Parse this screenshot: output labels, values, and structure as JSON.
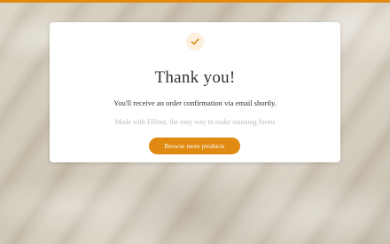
{
  "colors": {
    "accent": "#e08a12",
    "check_bg": "#fcefdc",
    "card_bg": "#ffffff"
  },
  "confirmation": {
    "icon": "check-icon",
    "title": "Thank you!",
    "message": "You'll receive an order confirmation via email shortly.",
    "made_with": "Made with Fillout, the easy way to make stunning forms",
    "button_label": "Browse more products"
  }
}
